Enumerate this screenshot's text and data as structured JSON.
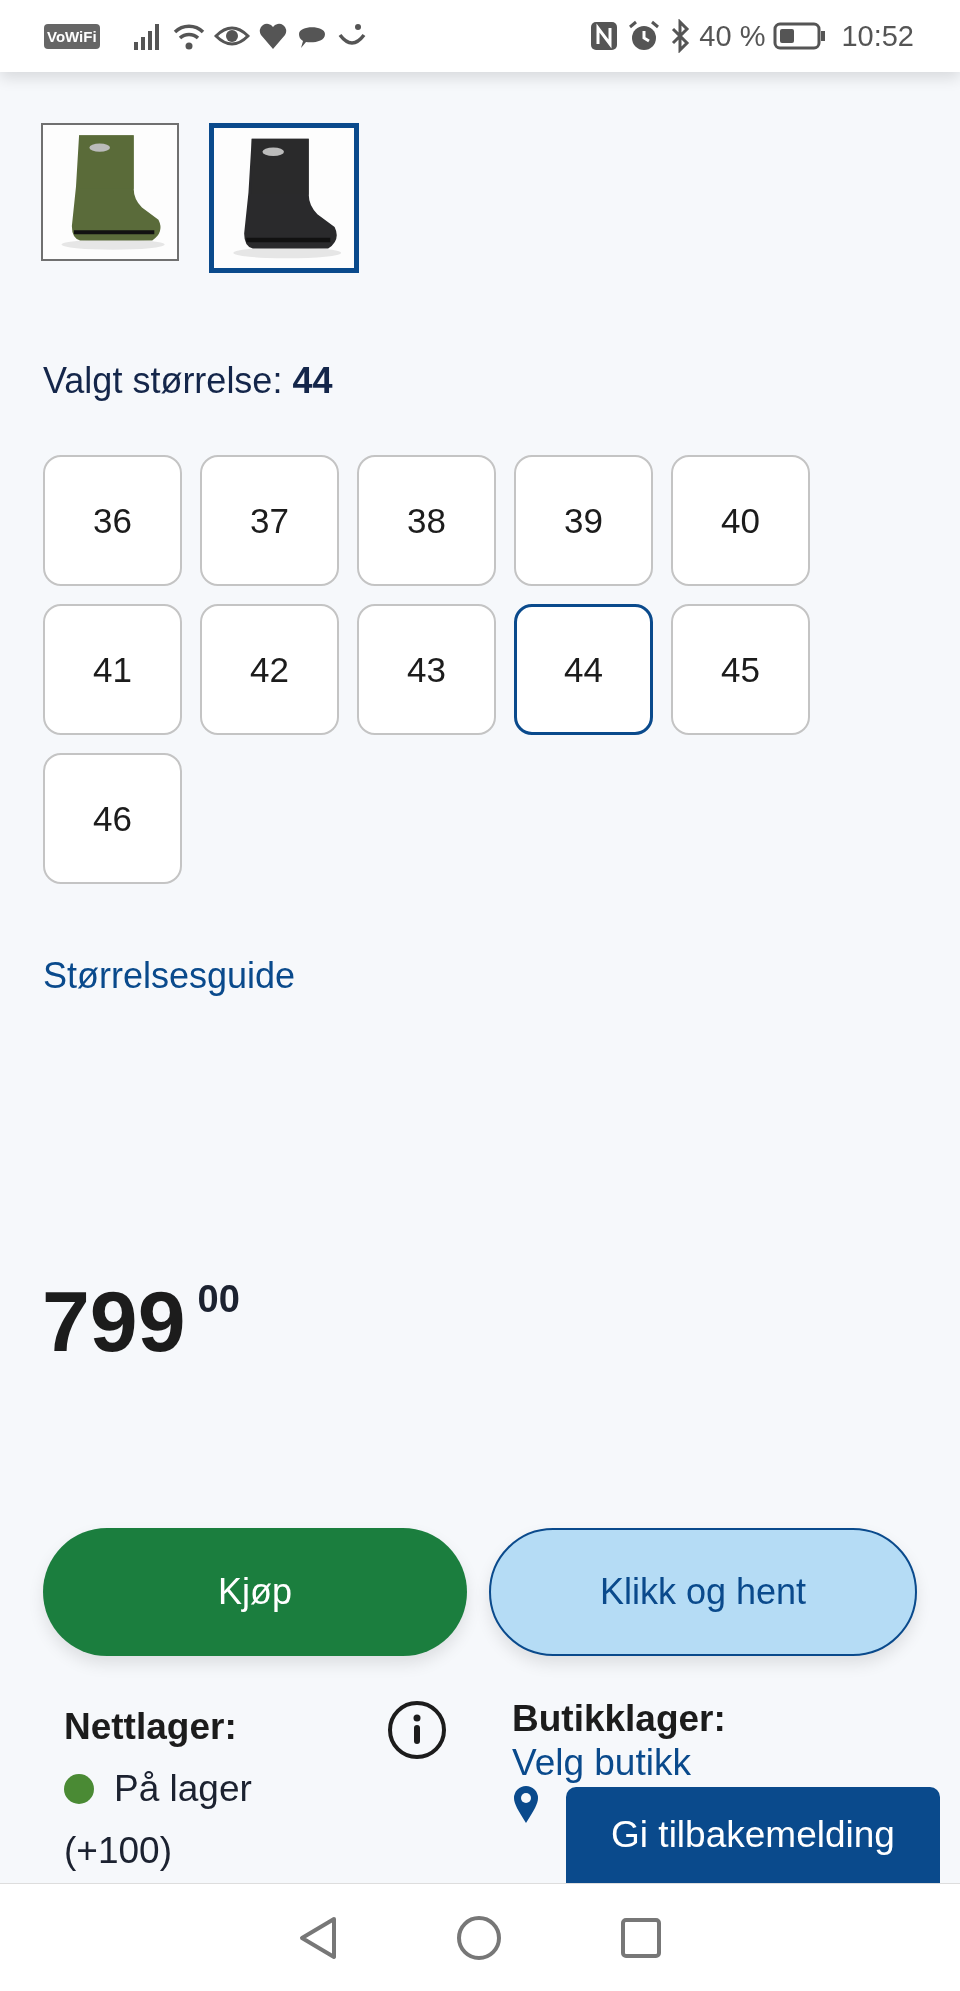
{
  "status_bar": {
    "wifi_calling": "VoWiFi",
    "battery": "40 %",
    "time": "10:52"
  },
  "thumbnails": [
    {
      "kind": "picture",
      "color": "#5a6b3a",
      "selected": false
    },
    {
      "kind": "picture",
      "color": "#2a2a2c",
      "selected": true
    }
  ],
  "size_label": "Valgt størrelse:",
  "selected_size": "44",
  "sizes": [
    {
      "label": "36",
      "selected": false
    },
    {
      "label": "37",
      "selected": false
    },
    {
      "label": "38",
      "selected": false
    },
    {
      "label": "39",
      "selected": false
    },
    {
      "label": "40",
      "selected": false
    },
    {
      "label": "41",
      "selected": false
    },
    {
      "label": "42",
      "selected": false
    },
    {
      "label": "43",
      "selected": false
    },
    {
      "label": "44",
      "selected": true
    },
    {
      "label": "45",
      "selected": false
    },
    {
      "label": "46",
      "selected": false
    }
  ],
  "size_guide": "Størrelsesguide",
  "price": {
    "main": "799",
    "cents": "00"
  },
  "buttons": [
    {
      "label": "Kjøp",
      "kind": "primary"
    },
    {
      "label": "Klikk og hent",
      "kind": "secondary"
    }
  ],
  "online_stock": {
    "label": "Nettlager:",
    "status": "På lager",
    "color": "#4a8a34",
    "count": "(+100)"
  },
  "store_stock": {
    "label": "Butikklager:",
    "link": "Velg butikk"
  },
  "feedback": "Gi tilbakemelding"
}
